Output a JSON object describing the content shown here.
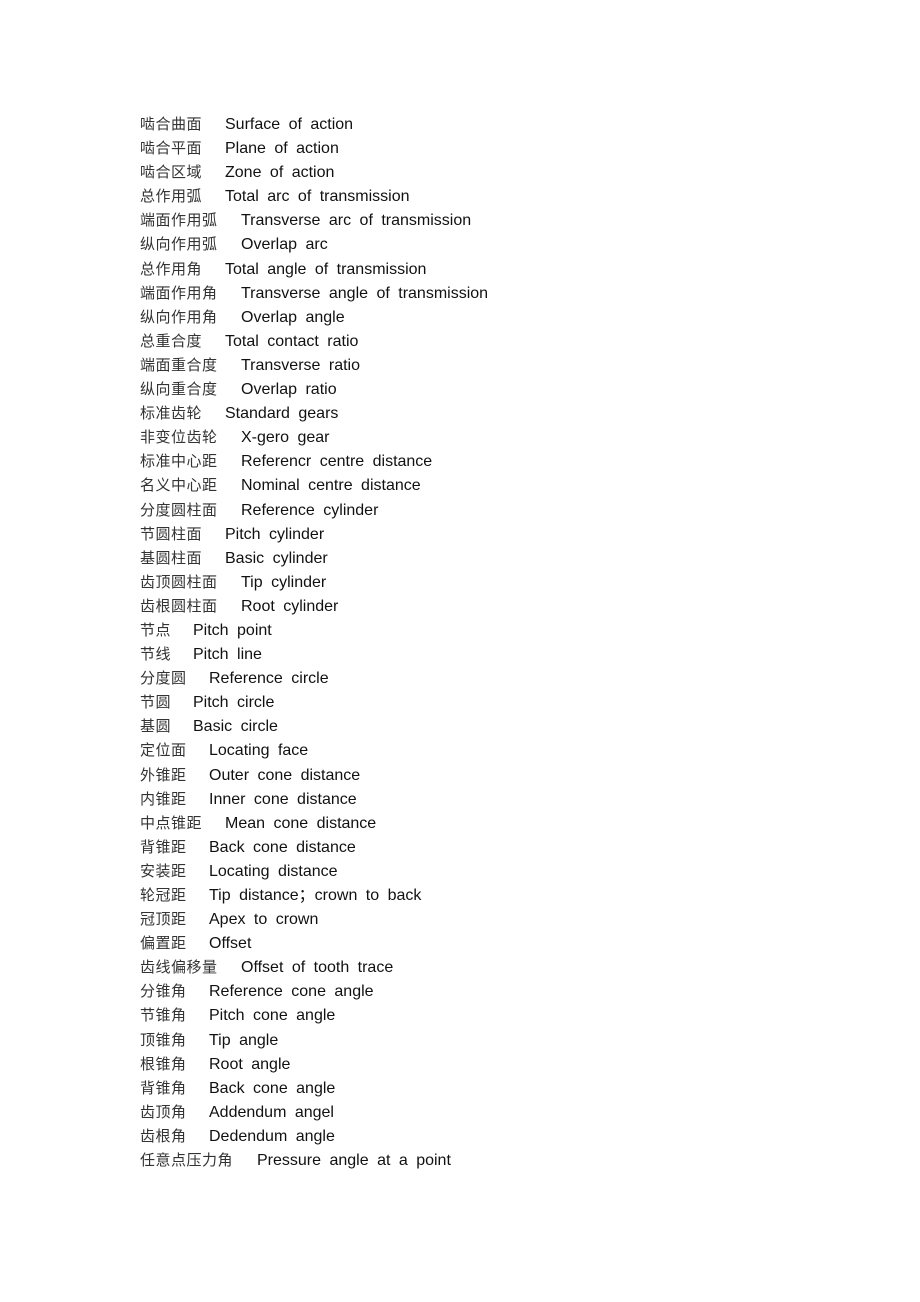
{
  "document": {
    "entries": [
      {
        "zh": "啮合曲面",
        "en": "Surface of action"
      },
      {
        "zh": "啮合平面",
        "en": "Plane of action"
      },
      {
        "zh": "啮合区域",
        "en": "Zone of action"
      },
      {
        "zh": "总作用弧",
        "en": "Total arc of transmission"
      },
      {
        "zh": "端面作用弧",
        "en": "Transverse arc of transmission"
      },
      {
        "zh": "纵向作用弧",
        "en": "Overlap arc"
      },
      {
        "zh": "总作用角",
        "en": "Total angle of transmission"
      },
      {
        "zh": "端面作用角",
        "en": "Transverse angle of transmission"
      },
      {
        "zh": "纵向作用角",
        "en": "Overlap angle"
      },
      {
        "zh": "总重合度",
        "en": "Total contact ratio"
      },
      {
        "zh": "端面重合度",
        "en": "Transverse ratio"
      },
      {
        "zh": "纵向重合度",
        "en": "Overlap ratio"
      },
      {
        "zh": "标准齿轮",
        "en": "Standard gears"
      },
      {
        "zh": "非变位齿轮",
        "en": "X-gero gear"
      },
      {
        "zh": "标准中心距",
        "en": "Referencr centre distance"
      },
      {
        "zh": "名义中心距",
        "en": "Nominal centre distance"
      },
      {
        "zh": "分度圆柱面",
        "en": "Reference cylinder"
      },
      {
        "zh": "节圆柱面",
        "en": "Pitch cylinder"
      },
      {
        "zh": "基圆柱面",
        "en": "Basic cylinder"
      },
      {
        "zh": "齿顶圆柱面",
        "en": "Tip cylinder"
      },
      {
        "zh": "齿根圆柱面",
        "en": "Root cylinder"
      },
      {
        "zh": "节点",
        "en": "Pitch point"
      },
      {
        "zh": "节线",
        "en": "Pitch line"
      },
      {
        "zh": "分度圆",
        "en": "Reference circle"
      },
      {
        "zh": "节圆",
        "en": "Pitch circle"
      },
      {
        "zh": "基圆",
        "en": "Basic circle"
      },
      {
        "zh": "定位面",
        "en": "Locating face"
      },
      {
        "zh": "外锥距",
        "en": "Outer cone distance"
      },
      {
        "zh": "内锥距",
        "en": "Inner cone distance"
      },
      {
        "zh": "中点锥距",
        "en": "Mean cone distance"
      },
      {
        "zh": "背锥距",
        "en": "Back cone distance"
      },
      {
        "zh": "安装距",
        "en": "Locating distance"
      },
      {
        "zh": "轮冠距",
        "en": "Tip distance；crown to back"
      },
      {
        "zh": "冠顶距",
        "en": "Apex to crown"
      },
      {
        "zh": "偏置距",
        "en": "Offset"
      },
      {
        "zh": "齿线偏移量",
        "en": "Offset of tooth trace"
      },
      {
        "zh": "分锥角",
        "en": "Reference cone angle"
      },
      {
        "zh": "节锥角",
        "en": "Pitch cone angle"
      },
      {
        "zh": "顶锥角",
        "en": "Tip angle"
      },
      {
        "zh": "根锥角",
        "en": "Root angle"
      },
      {
        "zh": "背锥角",
        "en": "Back cone angle"
      },
      {
        "zh": "齿顶角",
        "en": "Addendum angel"
      },
      {
        "zh": "齿根角",
        "en": "Dedendum angle"
      },
      {
        "zh": "任意点压力角",
        "en": "Pressure angle at a point"
      }
    ]
  }
}
